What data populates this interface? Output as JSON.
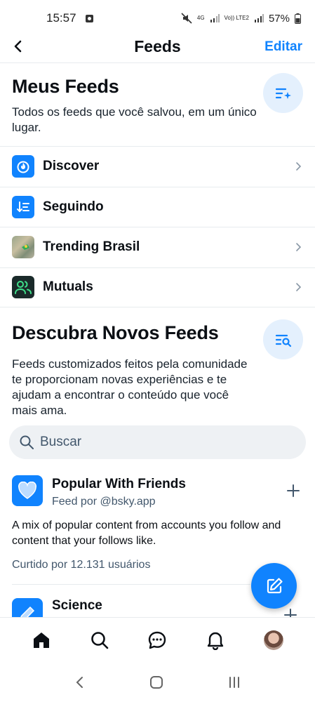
{
  "status_bar": {
    "time": "15:57",
    "network": "4G",
    "volte": "Vo)) LTE2",
    "battery": "57%"
  },
  "header": {
    "title": "Feeds",
    "edit_label": "Editar"
  },
  "my_feeds": {
    "title": "Meus Feeds",
    "description": "Todos os feeds que você salvou, em um único lugar.",
    "items": [
      {
        "label": "Discover",
        "icon": "bluesky-discover-icon",
        "chevron": true
      },
      {
        "label": "Seguindo",
        "icon": "following-sort-icon",
        "chevron": false
      },
      {
        "label": "Trending Brasil",
        "icon": "trending-brasil-thumbnail",
        "chevron": true
      },
      {
        "label": "Mutuals",
        "icon": "mutuals-people-icon",
        "chevron": true
      }
    ]
  },
  "discover": {
    "title": "Descubra Novos Feeds",
    "description": "Feeds customizados feitos pela comunidade te proporcionam novas experiências e te ajudam a encontrar o conteúdo que você mais ama."
  },
  "search": {
    "placeholder": "Buscar"
  },
  "suggested_feeds": [
    {
      "title": "Popular With Friends",
      "subtitle": "Feed por @bsky.app",
      "description": "A mix of popular content from accounts you follow and content that your follows like.",
      "likes": "Curtido por 12.131 usuários"
    },
    {
      "title": "Science"
    }
  ],
  "colors": {
    "accent": "#1083fe",
    "light_accent_bg": "#e4f0fd",
    "divider": "#e7ebee",
    "muted_text": "#42576c"
  }
}
